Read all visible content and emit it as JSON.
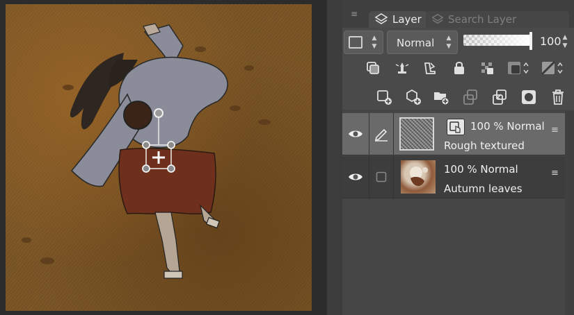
{
  "panel": {
    "tabs": [
      {
        "label": "Layer",
        "icon": "layers-icon",
        "active": true
      },
      {
        "label": "Search Layer",
        "icon": "search-layer-icon",
        "active": false
      }
    ]
  },
  "controls": {
    "blend_mode": "Normal",
    "opacity_value": "100",
    "opacity_fraction": 1.0,
    "row1_icons": [
      "clipping-icon",
      "reference-layer-icon",
      "draft-layer-icon",
      "lock-icon",
      "lock-transparent-icon",
      "mask-display-icon",
      "mask-range-icon"
    ],
    "row2_icons": [
      "new-raster-layer-icon",
      "new-vector-layer-icon",
      "new-folder-icon",
      "transfer-below-icon",
      "merge-below-icon",
      "create-mask-icon",
      "delete-layer-icon"
    ]
  },
  "layers": [
    {
      "name": "Rough textured",
      "meta": "100 %  Normal",
      "visible": true,
      "selected": true,
      "editing": true
    },
    {
      "name": "Autumn leaves",
      "meta": "100 %  Normal",
      "visible": true,
      "selected": false,
      "editing": false
    }
  ],
  "colors": {
    "canvas_base": "#7a5526",
    "panel_bg": "#444444",
    "selected_row": "#6a6a6a",
    "kimono_fill": "#8a8d99",
    "pants_fill": "#6e2f1c"
  }
}
